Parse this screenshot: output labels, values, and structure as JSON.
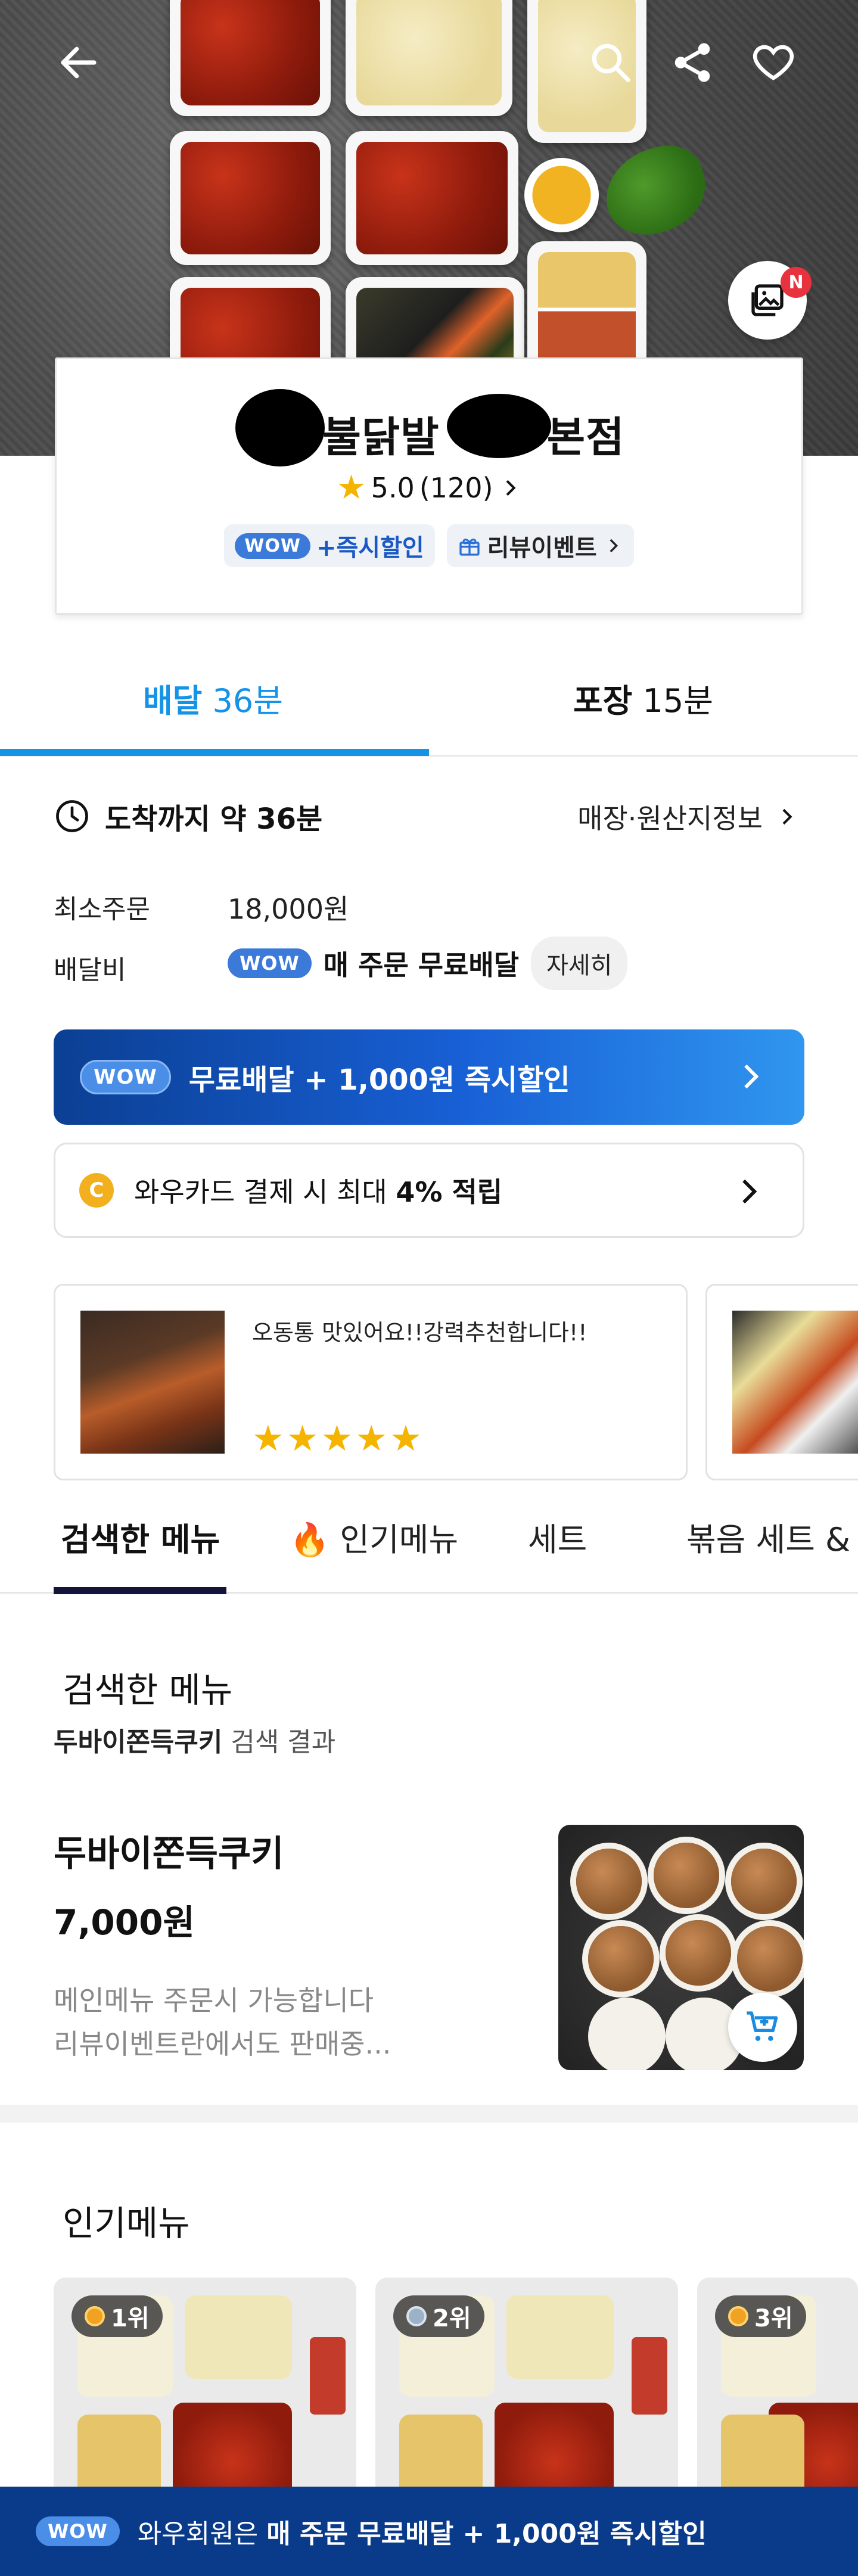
{
  "store": {
    "name_visible": "불닭발",
    "name_suffix": "본점",
    "rating": "5.0",
    "review_count": "(120)",
    "wow_badge": "WOW",
    "discount_chip": "+즉시할인",
    "review_event_chip": "리뷰이벤트",
    "photo_badge": "N"
  },
  "mode_tabs": [
    {
      "label": "배달",
      "time": "36분",
      "active": true
    },
    {
      "label": "포장",
      "time": "15분",
      "active": false
    }
  ],
  "info": {
    "arrival": "도착까지 약 36분",
    "store_info_link": "매장·원산지정보",
    "min_order_label": "최소주문",
    "min_order_value": "18,000원",
    "delivery_fee_label": "배달비",
    "delivery_wow": "WOW",
    "delivery_fee_value": "매 주문 무료배달",
    "detail_button": "자세히"
  },
  "promo_banner": {
    "wow": "WOW",
    "text": "무료배달 + 1,000원 즉시할인"
  },
  "card_banner": {
    "coin": "C",
    "text_prefix": "와우카드 결제 시 최대 ",
    "text_bold": "4% 적립"
  },
  "reviews": [
    {
      "text": "오동통 맛있어요!!강력추천합니다!!",
      "stars": "★★★★★"
    }
  ],
  "menu_tabs": [
    {
      "label": "검색한 메뉴",
      "active": true
    },
    {
      "label": "🔥 인기메뉴",
      "active": false
    },
    {
      "label": "세트",
      "active": false
    },
    {
      "label": "볶음 세트 &",
      "active": false
    }
  ],
  "searched": {
    "title": "검색한 메뉴",
    "query": "두바이쫀득쿠키",
    "result_suffix": " 검색 결과",
    "item_name": "두바이쫀득쿠키",
    "item_price": "7,000원",
    "desc_line1": "메인메뉴 주문시 가능합니다",
    "desc_line2": "리뷰이벤트란에서도 판매중..."
  },
  "popular": {
    "title": "인기메뉴",
    "ranks": [
      "1위",
      "2위",
      "3위"
    ]
  },
  "bottom_banner": {
    "wow": "WOW",
    "prefix": "와우회원은 ",
    "bold": "매 주문 무료배달 + 1,000원 즉시할인"
  },
  "colors": {
    "accent": "#1593e6",
    "promo_start": "#0b3f93",
    "promo_end": "#3096ef",
    "star": "#f5b400",
    "badge_red": "#e8323d"
  }
}
